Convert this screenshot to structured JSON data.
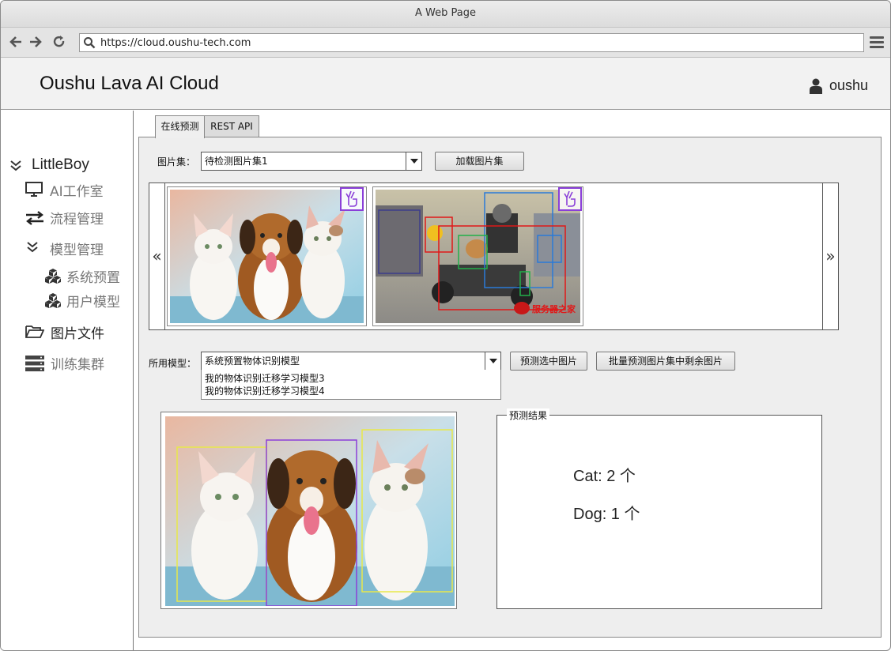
{
  "browser": {
    "window_title": "A Web Page",
    "url": "https://cloud.oushu-tech.com",
    "back_icon": "arrow-left-icon",
    "forward_icon": "arrow-right-icon",
    "reload_icon": "reload-icon",
    "menu_icon": "hamburger-menu-icon"
  },
  "header": {
    "title": "Oushu Lava AI Cloud",
    "user_name": "oushu",
    "user_icon": "user-icon"
  },
  "sidebar": {
    "root": {
      "label": "LittleBoy",
      "icon": "chevron-down-icon"
    },
    "items": [
      {
        "label": "AI工作室",
        "icon": "monitor-icon"
      },
      {
        "label": "流程管理",
        "icon": "swap-arrows-icon"
      },
      {
        "label": "模型管理",
        "icon": "chevron-down-icon"
      },
      {
        "label": "系统预置",
        "icon": "cubes-icon"
      },
      {
        "label": "用户模型",
        "icon": "cubes-icon"
      },
      {
        "label": "图片文件",
        "icon": "folder-open-icon"
      },
      {
        "label": "训练集群",
        "icon": "server-icon"
      }
    ]
  },
  "tabs": [
    {
      "label": "在线预测",
      "active": true
    },
    {
      "label": "REST API",
      "active": false
    }
  ],
  "image_set": {
    "label": "图片集：",
    "selected": "待检测图片集1",
    "load_button": "加载图片集"
  },
  "carousel": {
    "prev_label": "«",
    "next_label": "»",
    "thumbnails": [
      {
        "name": "cats-and-dog-thumbnail",
        "selected_badge": "hand-pointer-icon"
      },
      {
        "name": "motorcycle-street-thumbnail",
        "selected_badge": "hand-pointer-icon",
        "watermark": "服务器之家"
      }
    ]
  },
  "model": {
    "label": "所用模型：",
    "selected": "系统预置物体识别模型",
    "options": [
      "我的物体识别迁移学习模型3",
      "我的物体识别迁移学习模型4"
    ],
    "predict_selected_button": "预测选中图片",
    "batch_predict_button": "批量预测图片集中剩余图片"
  },
  "results": {
    "legend": "预测结果",
    "lines": [
      "Cat: 2  个",
      "Dog: 1  个"
    ]
  },
  "colors": {
    "accent_purple": "#8a3fd8",
    "box_yellow": "#e8e84a",
    "box_purple": "#8b3fd9"
  }
}
